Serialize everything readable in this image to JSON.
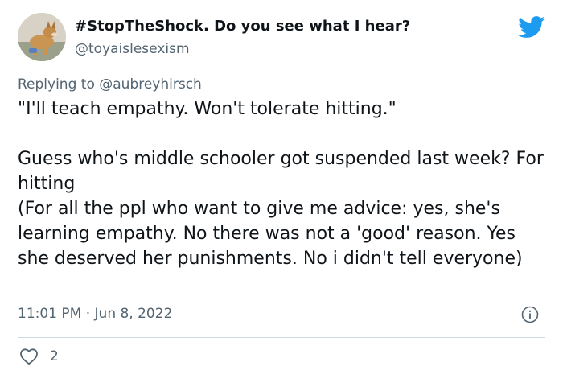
{
  "author": {
    "display_name": "#StopTheShock. Do you see what I hear?",
    "handle": "@toyaislesexism",
    "avatar": "dog-photo"
  },
  "brand": {
    "icon": "twitter-bird-icon",
    "color": "#1d9bf0"
  },
  "reply": {
    "prefix": "Replying to ",
    "mention": "@aubreyhirsch"
  },
  "tweet": {
    "line1": "\"I'll teach empathy. Won't tolerate hitting.\"",
    "line2": "Guess who's middle schooler got suspended last week? For hitting",
    "line3": "(For all the ppl who want to give me advice: yes, she's learning empathy. No there was not a 'good' reason. Yes she deserved her punishments. No i didn't tell everyone)"
  },
  "meta": {
    "timestamp": "11:01 PM · Jun 8, 2022",
    "info_icon": "info-icon"
  },
  "actions": {
    "like_icon": "heart-icon",
    "like_count": "2"
  },
  "colors": {
    "text": "#0f1419",
    "muted": "#536471",
    "divider": "#cfd9de"
  }
}
